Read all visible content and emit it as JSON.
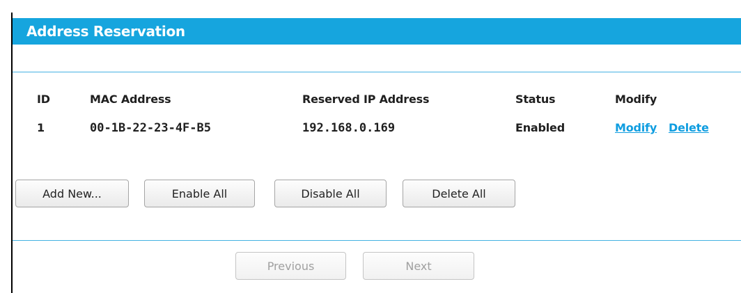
{
  "title": "Address Reservation",
  "table": {
    "headers": {
      "id": "ID",
      "mac": "MAC Address",
      "ip": "Reserved IP Address",
      "status": "Status",
      "modify": "Modify"
    },
    "rows": [
      {
        "id": "1",
        "mac": "00-1B-22-23-4F-B5",
        "ip": "192.168.0.169",
        "status": "Enabled",
        "modify_link": "Modify",
        "delete_link": "Delete"
      }
    ]
  },
  "actions": {
    "add_new": "Add New...",
    "enable_all": "Enable All",
    "disable_all": "Disable All",
    "delete_all": "Delete All"
  },
  "pagination": {
    "previous": "Previous",
    "next": "Next"
  },
  "colors": {
    "title_bar": "#16a5de",
    "divider": "#44b2e2",
    "link": "#0f9de0"
  }
}
